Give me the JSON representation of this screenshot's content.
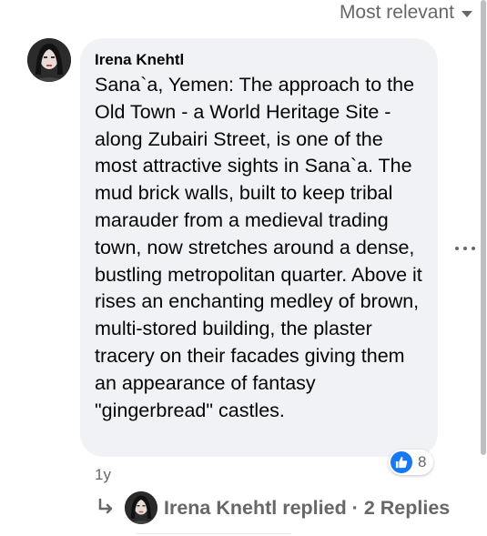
{
  "sort": {
    "label": "Most relevant"
  },
  "comment": {
    "author": "Irena Knehtl",
    "text": "Sana`a, Yemen: The approach to the Old Town - a World Heritage Site - along Zubairi Street, is one of the most attractive sights in Sana`a. The mud brick walls, built to keep tribal marauder from a medieval trading town, now stretches around a dense, bustling metropolitan quarter. Above it rises an enchanting medley of brown, multi-stored building, the plaster tracery on their facades giving them an appearance of fantasy \"gingerbread\" castles.",
    "timestamp": "1y",
    "reaction_count": "8",
    "reaction_icon": "like-icon"
  },
  "replies": {
    "label": "Irena Knehtl replied · 2 Replies"
  },
  "colors": {
    "like_blue": "#1877f2",
    "bubble_bg": "#f0f2f5",
    "secondary_text": "#65676b"
  }
}
